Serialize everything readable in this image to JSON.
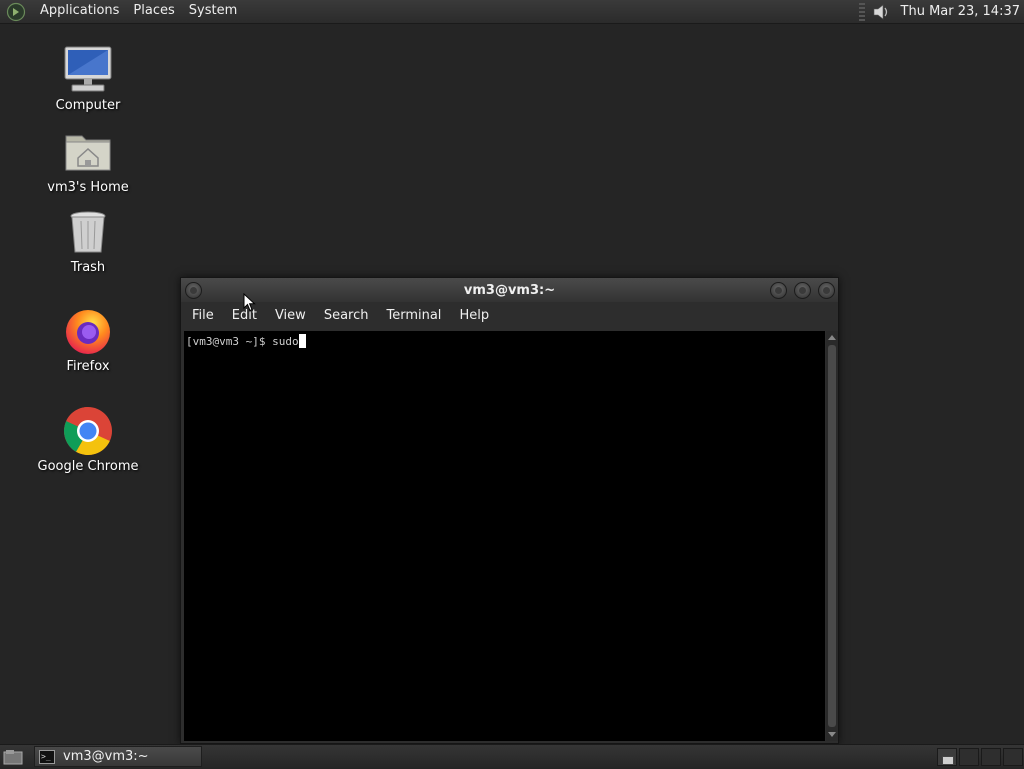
{
  "top_panel": {
    "menus": [
      "Applications",
      "Places",
      "System"
    ],
    "clock": "Thu Mar 23, 14:37",
    "icons": {
      "logo": "gnome-foot-icon",
      "volume": "volume-icon"
    }
  },
  "desktop": {
    "icons": [
      {
        "label": "Computer",
        "icon": "computer-icon"
      },
      {
        "label": "vm3's Home",
        "icon": "home-folder-icon"
      },
      {
        "label": "Trash",
        "icon": "trash-icon"
      },
      {
        "label": "Firefox",
        "icon": "firefox-icon"
      },
      {
        "label": "Google Chrome",
        "icon": "chrome-icon"
      }
    ]
  },
  "terminal": {
    "title": "vm3@vm3:~",
    "menus": [
      "File",
      "Edit",
      "View",
      "Search",
      "Terminal",
      "Help"
    ],
    "prompt": "[vm3@vm3 ~]$ ",
    "command": "sudo"
  },
  "bottom_panel": {
    "tasks": [
      {
        "label": "vm3@vm3:~",
        "icon": "terminal-icon"
      }
    ]
  },
  "colors": {
    "desktop_bg": "#252525",
    "panel_bg": "#2b2b2b",
    "terminal_bg": "#000000",
    "terminal_fg": "#d0d0d0"
  }
}
